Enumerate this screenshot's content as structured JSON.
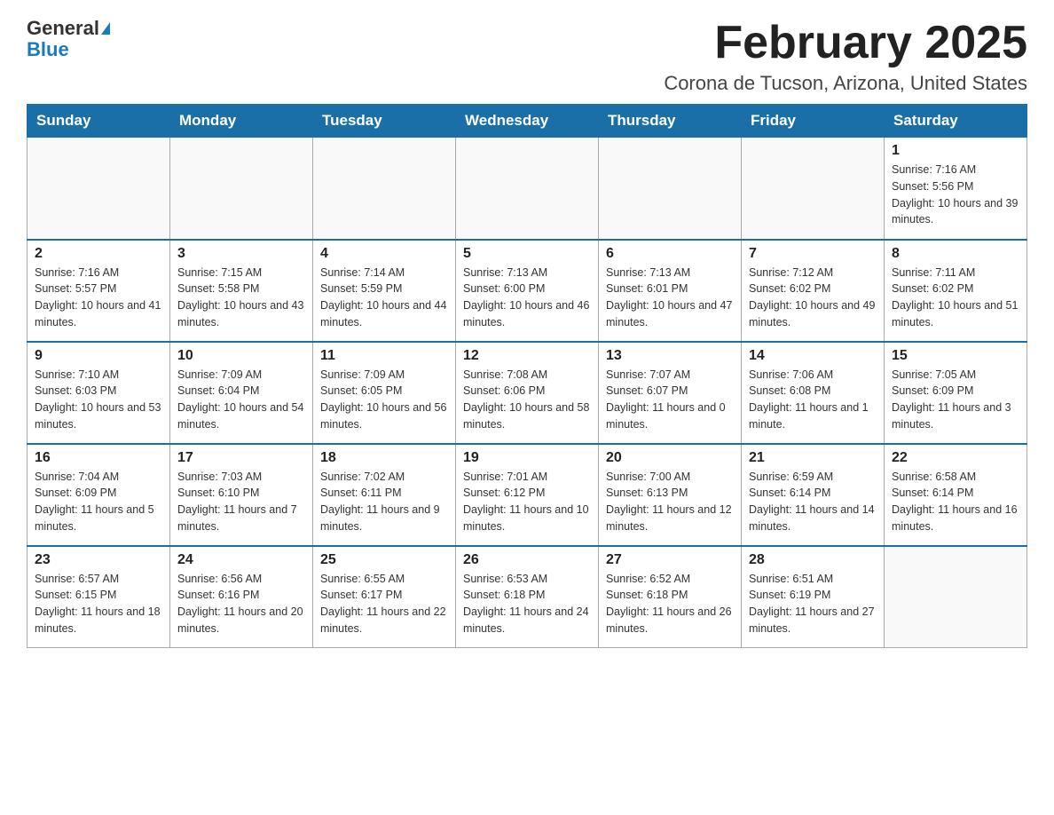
{
  "logo": {
    "general": "General",
    "blue": "Blue"
  },
  "title": "February 2025",
  "location": "Corona de Tucson, Arizona, United States",
  "days_of_week": [
    "Sunday",
    "Monday",
    "Tuesday",
    "Wednesday",
    "Thursday",
    "Friday",
    "Saturday"
  ],
  "weeks": [
    [
      {
        "day": "",
        "info": ""
      },
      {
        "day": "",
        "info": ""
      },
      {
        "day": "",
        "info": ""
      },
      {
        "day": "",
        "info": ""
      },
      {
        "day": "",
        "info": ""
      },
      {
        "day": "",
        "info": ""
      },
      {
        "day": "1",
        "info": "Sunrise: 7:16 AM\nSunset: 5:56 PM\nDaylight: 10 hours and 39 minutes."
      }
    ],
    [
      {
        "day": "2",
        "info": "Sunrise: 7:16 AM\nSunset: 5:57 PM\nDaylight: 10 hours and 41 minutes."
      },
      {
        "day": "3",
        "info": "Sunrise: 7:15 AM\nSunset: 5:58 PM\nDaylight: 10 hours and 43 minutes."
      },
      {
        "day": "4",
        "info": "Sunrise: 7:14 AM\nSunset: 5:59 PM\nDaylight: 10 hours and 44 minutes."
      },
      {
        "day": "5",
        "info": "Sunrise: 7:13 AM\nSunset: 6:00 PM\nDaylight: 10 hours and 46 minutes."
      },
      {
        "day": "6",
        "info": "Sunrise: 7:13 AM\nSunset: 6:01 PM\nDaylight: 10 hours and 47 minutes."
      },
      {
        "day": "7",
        "info": "Sunrise: 7:12 AM\nSunset: 6:02 PM\nDaylight: 10 hours and 49 minutes."
      },
      {
        "day": "8",
        "info": "Sunrise: 7:11 AM\nSunset: 6:02 PM\nDaylight: 10 hours and 51 minutes."
      }
    ],
    [
      {
        "day": "9",
        "info": "Sunrise: 7:10 AM\nSunset: 6:03 PM\nDaylight: 10 hours and 53 minutes."
      },
      {
        "day": "10",
        "info": "Sunrise: 7:09 AM\nSunset: 6:04 PM\nDaylight: 10 hours and 54 minutes."
      },
      {
        "day": "11",
        "info": "Sunrise: 7:09 AM\nSunset: 6:05 PM\nDaylight: 10 hours and 56 minutes."
      },
      {
        "day": "12",
        "info": "Sunrise: 7:08 AM\nSunset: 6:06 PM\nDaylight: 10 hours and 58 minutes."
      },
      {
        "day": "13",
        "info": "Sunrise: 7:07 AM\nSunset: 6:07 PM\nDaylight: 11 hours and 0 minutes."
      },
      {
        "day": "14",
        "info": "Sunrise: 7:06 AM\nSunset: 6:08 PM\nDaylight: 11 hours and 1 minute."
      },
      {
        "day": "15",
        "info": "Sunrise: 7:05 AM\nSunset: 6:09 PM\nDaylight: 11 hours and 3 minutes."
      }
    ],
    [
      {
        "day": "16",
        "info": "Sunrise: 7:04 AM\nSunset: 6:09 PM\nDaylight: 11 hours and 5 minutes."
      },
      {
        "day": "17",
        "info": "Sunrise: 7:03 AM\nSunset: 6:10 PM\nDaylight: 11 hours and 7 minutes."
      },
      {
        "day": "18",
        "info": "Sunrise: 7:02 AM\nSunset: 6:11 PM\nDaylight: 11 hours and 9 minutes."
      },
      {
        "day": "19",
        "info": "Sunrise: 7:01 AM\nSunset: 6:12 PM\nDaylight: 11 hours and 10 minutes."
      },
      {
        "day": "20",
        "info": "Sunrise: 7:00 AM\nSunset: 6:13 PM\nDaylight: 11 hours and 12 minutes."
      },
      {
        "day": "21",
        "info": "Sunrise: 6:59 AM\nSunset: 6:14 PM\nDaylight: 11 hours and 14 minutes."
      },
      {
        "day": "22",
        "info": "Sunrise: 6:58 AM\nSunset: 6:14 PM\nDaylight: 11 hours and 16 minutes."
      }
    ],
    [
      {
        "day": "23",
        "info": "Sunrise: 6:57 AM\nSunset: 6:15 PM\nDaylight: 11 hours and 18 minutes."
      },
      {
        "day": "24",
        "info": "Sunrise: 6:56 AM\nSunset: 6:16 PM\nDaylight: 11 hours and 20 minutes."
      },
      {
        "day": "25",
        "info": "Sunrise: 6:55 AM\nSunset: 6:17 PM\nDaylight: 11 hours and 22 minutes."
      },
      {
        "day": "26",
        "info": "Sunrise: 6:53 AM\nSunset: 6:18 PM\nDaylight: 11 hours and 24 minutes."
      },
      {
        "day": "27",
        "info": "Sunrise: 6:52 AM\nSunset: 6:18 PM\nDaylight: 11 hours and 26 minutes."
      },
      {
        "day": "28",
        "info": "Sunrise: 6:51 AM\nSunset: 6:19 PM\nDaylight: 11 hours and 27 minutes."
      },
      {
        "day": "",
        "info": ""
      }
    ]
  ]
}
